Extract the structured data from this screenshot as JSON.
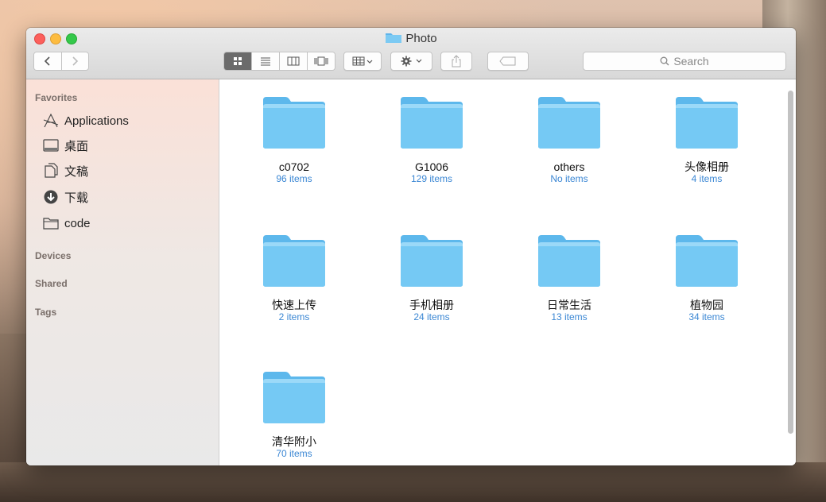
{
  "window": {
    "title": "Photo"
  },
  "toolbar": {
    "back_icon": "chevron-left-icon",
    "forward_icon": "chevron-right-icon",
    "view_modes": [
      "icon-view",
      "list-view",
      "column-view",
      "cover-flow-view"
    ],
    "arrange_icon": "arrange-icon",
    "action_icon": "gear-icon",
    "share_icon": "share-icon",
    "tag_icon": "tag-icon",
    "search_placeholder": "Search"
  },
  "sidebar": {
    "favorites_label": "Favorites",
    "favorites": [
      {
        "label": "Applications",
        "icon": "applications-icon"
      },
      {
        "label": "桌面",
        "icon": "desktop-icon"
      },
      {
        "label": "文稿",
        "icon": "documents-icon"
      },
      {
        "label": "下载",
        "icon": "downloads-icon"
      },
      {
        "label": "code",
        "icon": "folder-icon"
      }
    ],
    "devices_label": "Devices",
    "shared_label": "Shared",
    "tags_label": "Tags"
  },
  "folders": [
    {
      "name": "c0702",
      "count": "96 items"
    },
    {
      "name": "G1006",
      "count": "129 items"
    },
    {
      "name": "others",
      "count": "No items"
    },
    {
      "name": "头像相册",
      "count": "4 items"
    },
    {
      "name": "快速上传",
      "count": "2 items"
    },
    {
      "name": "手机相册",
      "count": "24 items"
    },
    {
      "name": "日常生活",
      "count": "13 items"
    },
    {
      "name": "植物园",
      "count": "34 items"
    },
    {
      "name": "清华附小",
      "count": "70 items"
    }
  ],
  "colors": {
    "folder": "#6cc2ef",
    "accent": "#3b87d4",
    "selected_view": "#6b6b6b"
  }
}
